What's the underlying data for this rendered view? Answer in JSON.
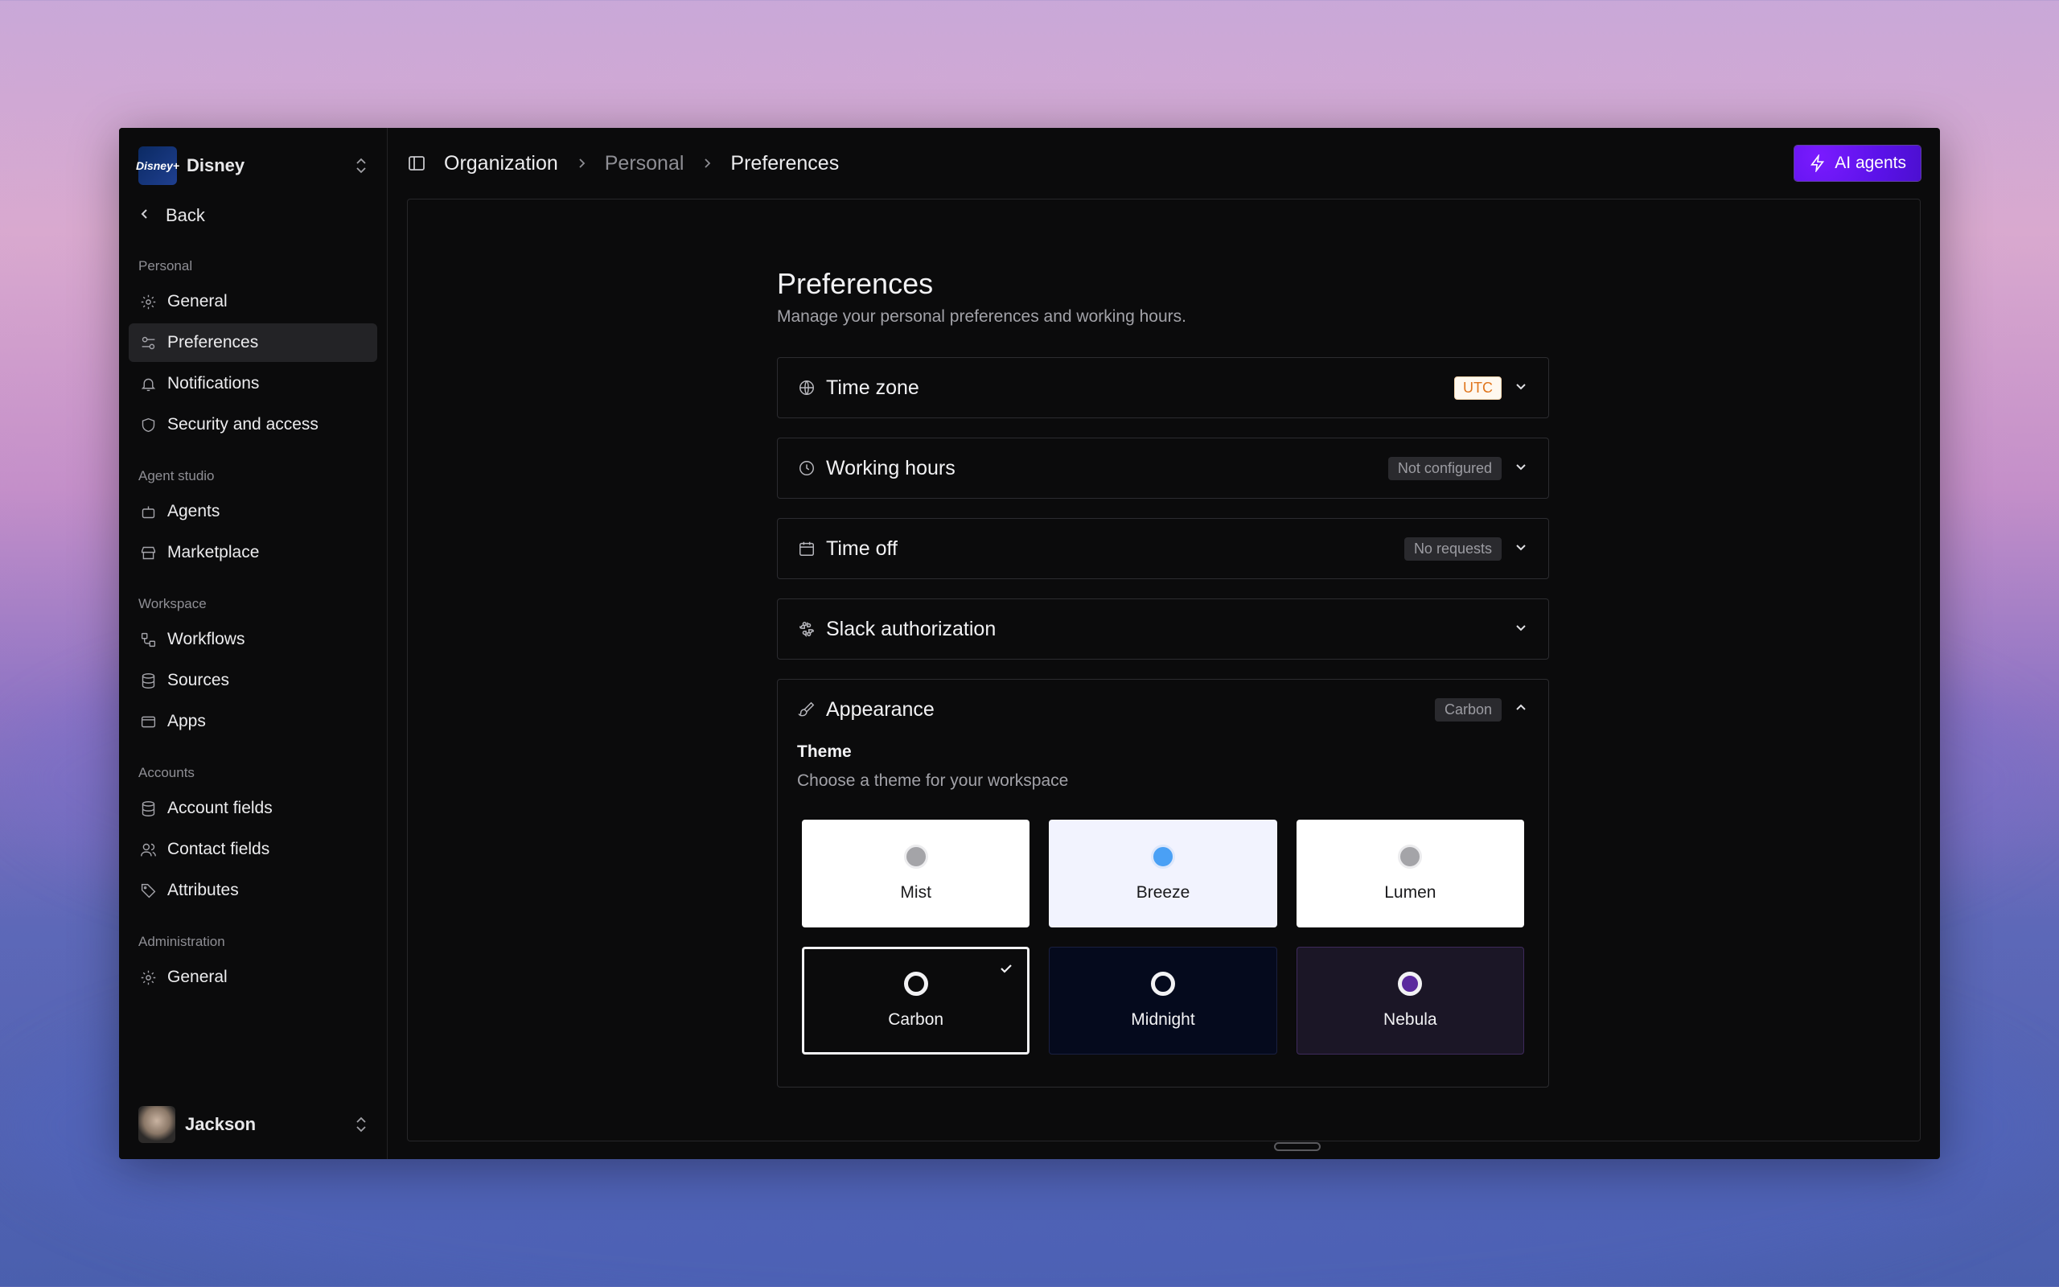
{
  "org": {
    "name": "Disney",
    "logo_text": "Disney+"
  },
  "back_label": "Back",
  "sidebar": {
    "sections": [
      {
        "label": "Personal",
        "items": [
          {
            "label": "General",
            "icon": "gear-icon"
          },
          {
            "label": "Preferences",
            "icon": "sliders-icon",
            "active": true
          },
          {
            "label": "Notifications",
            "icon": "bell-icon"
          },
          {
            "label": "Security and access",
            "icon": "shield-icon"
          }
        ]
      },
      {
        "label": "Agent studio",
        "items": [
          {
            "label": "Agents",
            "icon": "robot-icon"
          },
          {
            "label": "Marketplace",
            "icon": "store-icon"
          }
        ]
      },
      {
        "label": "Workspace",
        "items": [
          {
            "label": "Workflows",
            "icon": "workflow-icon"
          },
          {
            "label": "Sources",
            "icon": "database-icon"
          },
          {
            "label": "Apps",
            "icon": "app-window-icon"
          }
        ]
      },
      {
        "label": "Accounts",
        "items": [
          {
            "label": "Account fields",
            "icon": "database-icon"
          },
          {
            "label": "Contact fields",
            "icon": "users-icon"
          },
          {
            "label": "Attributes",
            "icon": "tag-icon"
          }
        ]
      },
      {
        "label": "Administration",
        "items": [
          {
            "label": "General",
            "icon": "gear-icon"
          }
        ]
      }
    ]
  },
  "user": {
    "name": "Jackson"
  },
  "breadcrumb": [
    "Organization",
    "Personal",
    "Preferences"
  ],
  "ai_button": "AI agents",
  "page": {
    "title": "Preferences",
    "subtitle": "Manage your personal preferences and working hours."
  },
  "sections": {
    "timezone": {
      "title": "Time zone",
      "badge": "UTC"
    },
    "working_hours": {
      "title": "Working hours",
      "badge": "Not configured"
    },
    "time_off": {
      "title": "Time off",
      "badge": "No requests"
    },
    "slack": {
      "title": "Slack authorization"
    },
    "appearance": {
      "title": "Appearance",
      "badge": "Carbon"
    }
  },
  "theme": {
    "label": "Theme",
    "description": "Choose a theme for your workspace",
    "options": [
      "Mist",
      "Breeze",
      "Lumen",
      "Carbon",
      "Midnight",
      "Nebula"
    ],
    "selected": "Carbon"
  },
  "colors": {
    "accent": "#5a12e8",
    "utc_badge_text": "#e0751c",
    "breeze_dot": "#4aa0f5",
    "nebula_dot": "#5b2a9e"
  }
}
